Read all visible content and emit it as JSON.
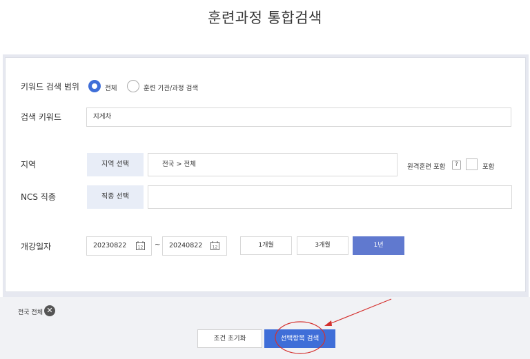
{
  "title": "훈련과정 통합검색",
  "form": {
    "keyword_scope": {
      "label": "키워드 검색 범위",
      "options": [
        "전체",
        "훈련 기관/과정 검색"
      ],
      "selected": 0
    },
    "keyword": {
      "label": "검색 키워드",
      "value": "지게차"
    },
    "region": {
      "label": "지역",
      "button": "지역 선택",
      "value": "전국 > 전체",
      "remote_label": "원격훈련 포함",
      "help": "?",
      "include_label": "포함"
    },
    "ncs": {
      "label": "NCS 직종",
      "button": "직종 선택",
      "value": ""
    },
    "date": {
      "label": "개강일자",
      "start": "20230822",
      "separator": "~",
      "end": "20240822",
      "periods": [
        "1개월",
        "3개월",
        "1년"
      ],
      "active_period": "1년"
    }
  },
  "selected_tags": [
    {
      "label": "전국 전체"
    }
  ],
  "actions": {
    "reset": "조건 초기화",
    "search": "선택항목 검색"
  },
  "colors": {
    "accent": "#3f6ed8",
    "active_period": "#6079cf",
    "annotation": "#d4302e"
  }
}
